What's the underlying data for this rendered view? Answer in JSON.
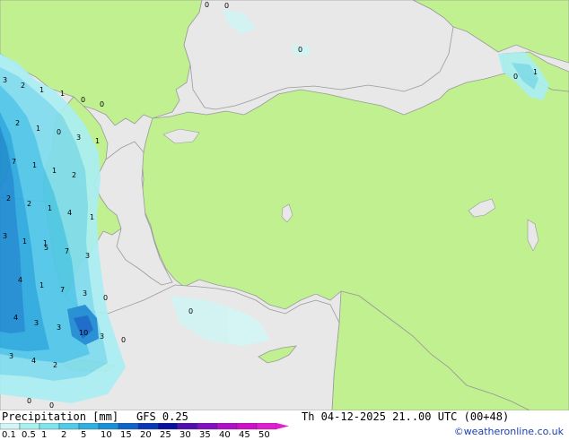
{
  "colors": {
    "sea": "#e8e8e8",
    "land": "#c0f090",
    "border": "#8a8a8a",
    "coast": "#9a9a9a"
  },
  "map_values": [
    {
      "v": "0",
      "pos": "1"
    },
    {
      "v": "0",
      "pos": "2"
    },
    {
      "v": "0",
      "pos": "3"
    },
    {
      "v": "0",
      "pos": "4"
    },
    {
      "v": "1",
      "pos": "5"
    },
    {
      "v": "3",
      "pos": "6"
    },
    {
      "v": "2",
      "pos": "7"
    },
    {
      "v": "1",
      "pos": "8"
    },
    {
      "v": "1",
      "pos": "9"
    },
    {
      "v": "0",
      "pos": "10"
    },
    {
      "v": "0",
      "pos": "11"
    },
    {
      "v": "2",
      "pos": "12"
    },
    {
      "v": "1",
      "pos": "13"
    },
    {
      "v": "0",
      "pos": "14"
    },
    {
      "v": "3",
      "pos": "15"
    },
    {
      "v": "1",
      "pos": "16"
    },
    {
      "v": "7",
      "pos": "17"
    },
    {
      "v": "1",
      "pos": "18"
    },
    {
      "v": "1",
      "pos": "19"
    },
    {
      "v": "2",
      "pos": "20"
    },
    {
      "v": "2",
      "pos": "21"
    },
    {
      "v": "2",
      "pos": "22"
    },
    {
      "v": "1",
      "pos": "23"
    },
    {
      "v": "1",
      "pos": "24"
    },
    {
      "v": "4",
      "pos": "25"
    },
    {
      "v": "1",
      "pos": "26"
    },
    {
      "v": "3",
      "pos": "27"
    },
    {
      "v": "1",
      "pos": "28"
    },
    {
      "v": "5",
      "pos": "29"
    },
    {
      "v": "7",
      "pos": "30"
    },
    {
      "v": "3",
      "pos": "31"
    },
    {
      "v": "4",
      "pos": "32"
    },
    {
      "v": "1",
      "pos": "33"
    },
    {
      "v": "7",
      "pos": "34"
    },
    {
      "v": "3",
      "pos": "35"
    },
    {
      "v": "0",
      "pos": "36"
    },
    {
      "v": "4",
      "pos": "37"
    },
    {
      "v": "3",
      "pos": "38"
    },
    {
      "v": "3",
      "pos": "39"
    },
    {
      "v": "10",
      "pos": "40"
    },
    {
      "v": "3",
      "pos": "41"
    },
    {
      "v": "0",
      "pos": "42"
    },
    {
      "v": "3",
      "pos": "43"
    },
    {
      "v": "4",
      "pos": "44"
    },
    {
      "v": "2",
      "pos": "45"
    },
    {
      "v": "0",
      "pos": "46"
    },
    {
      "v": "0",
      "pos": "47"
    },
    {
      "v": "0",
      "pos": "48"
    }
  ],
  "footer": {
    "title": "Precipitation [mm]",
    "model": "GFS 0.25",
    "datetime": "Th 04-12-2025 21..00 UTC (00+48)",
    "credit": "©weatheronline.co.uk"
  },
  "scale": {
    "labels": [
      "0.1",
      "0.5",
      "1",
      "2",
      "5",
      "10",
      "15",
      "20",
      "25",
      "30",
      "35",
      "40",
      "45",
      "50"
    ],
    "colors": [
      "#d2f5f5",
      "#aaf0f0",
      "#80e4ee",
      "#50cce8",
      "#30b0e0",
      "#1890d8",
      "#1064c8",
      "#0838b8",
      "#0810a0",
      "#5010b0",
      "#8010c0",
      "#b010c8",
      "#d010c8",
      "#e020d0"
    ]
  }
}
